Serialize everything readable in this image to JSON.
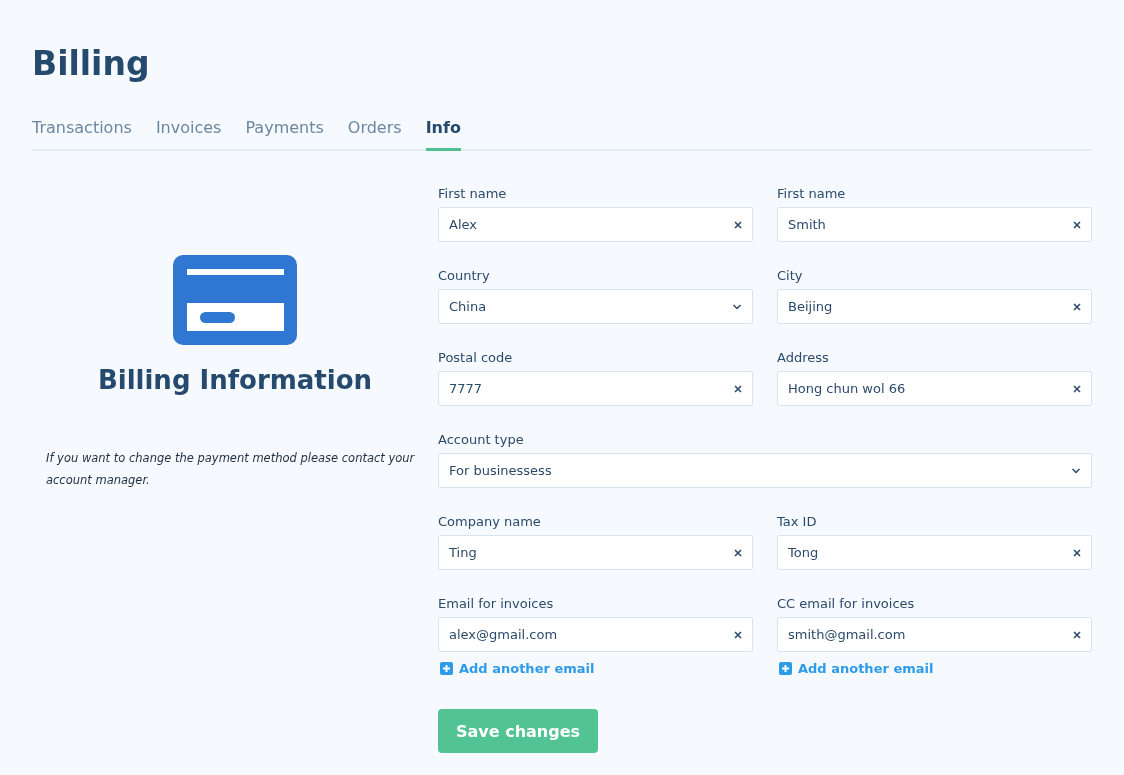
{
  "title": "Billing",
  "tabs": [
    {
      "label": "Transactions",
      "selected": false
    },
    {
      "label": "Invoices",
      "selected": false
    },
    {
      "label": "Payments",
      "selected": false
    },
    {
      "label": "Orders",
      "selected": false
    },
    {
      "label": "Info",
      "selected": true
    }
  ],
  "info_panel": {
    "heading": "Billing Information",
    "note": "If you want to change the payment method please contact your account manager."
  },
  "fields": [
    {
      "label": "First name",
      "value": "Alex",
      "kind": "text",
      "wide": false
    },
    {
      "label": "First name",
      "value": "Smith",
      "kind": "text",
      "wide": false
    },
    {
      "label": "Country",
      "value": "China",
      "kind": "select",
      "wide": false
    },
    {
      "label": "City",
      "value": "Beijing",
      "kind": "text",
      "wide": false
    },
    {
      "label": "Postal code",
      "value": "7777",
      "kind": "text",
      "wide": false
    },
    {
      "label": "Address",
      "value": "Hong chun wol 66",
      "kind": "text",
      "wide": false
    },
    {
      "label": "Account type",
      "value": "For businessess",
      "kind": "select",
      "wide": true
    },
    {
      "label": "Company name",
      "value": "Ting",
      "kind": "text",
      "wide": false
    },
    {
      "label": "Tax ID",
      "value": "Tong",
      "kind": "text",
      "wide": false
    },
    {
      "label": "Email for invoices",
      "value": "alex@gmail.com",
      "kind": "text",
      "wide": false,
      "link": "Add another email"
    },
    {
      "label": "CC email for invoices",
      "value": "smith@gmail.com",
      "kind": "text",
      "wide": false,
      "link": "Add another email"
    }
  ],
  "save_button": "Save changes"
}
